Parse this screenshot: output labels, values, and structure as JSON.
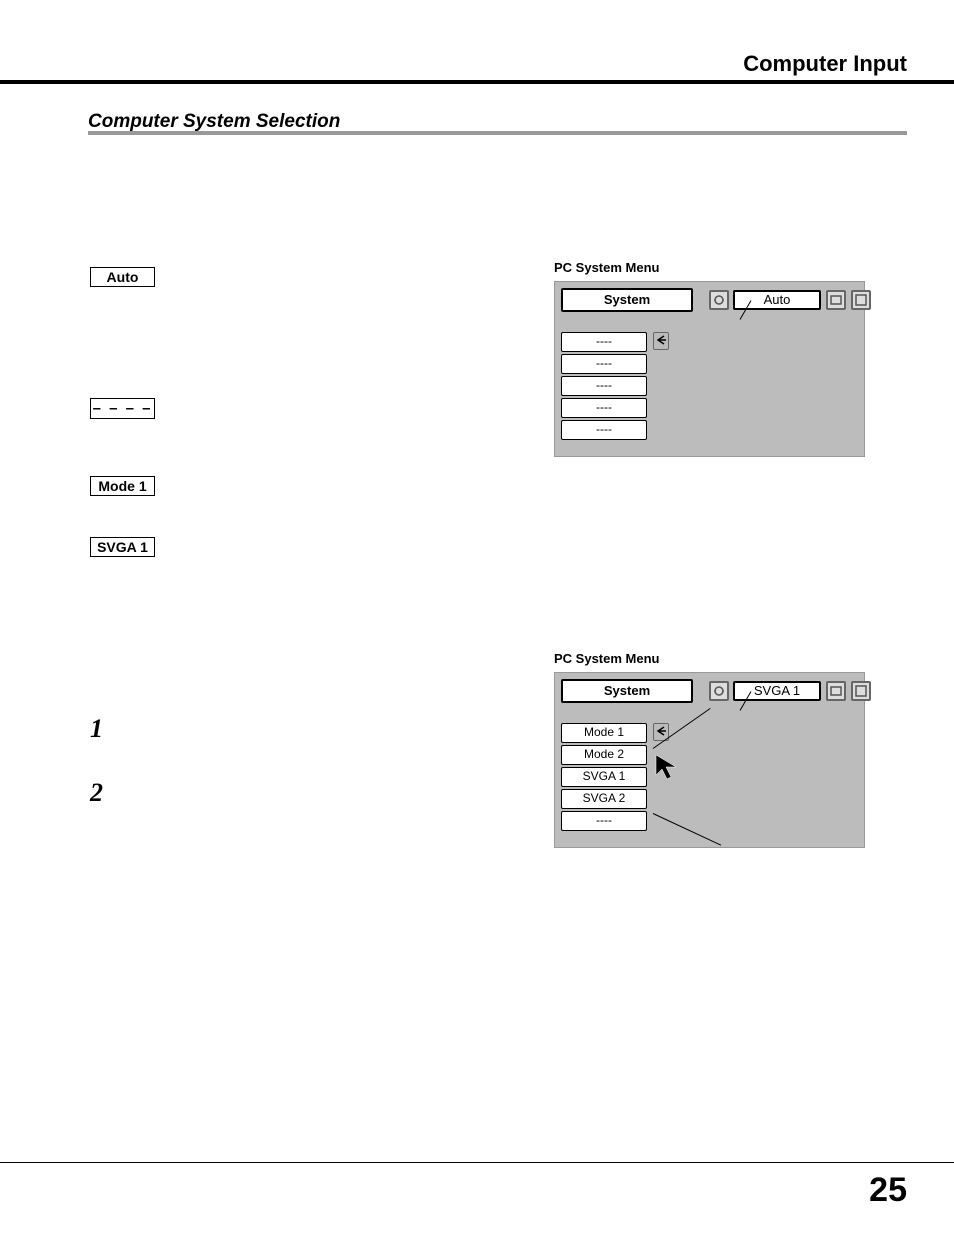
{
  "header": {
    "title": "Computer Input"
  },
  "section": {
    "title": "Computer System Selection"
  },
  "boxes": {
    "auto": "Auto",
    "dash": "– – – –",
    "mode1": "Mode 1",
    "svga1": "SVGA 1"
  },
  "menu1": {
    "caption": "PC System Menu",
    "title": "System",
    "value": "Auto",
    "items": [
      "----",
      "----",
      "----",
      "----",
      "----"
    ]
  },
  "menu2": {
    "caption": "PC System Menu",
    "title": "System",
    "value": "SVGA 1",
    "items": [
      "Mode 1",
      "Mode 2",
      "SVGA 1",
      "SVGA 2",
      "----"
    ]
  },
  "steps": {
    "one": "1",
    "two": "2"
  },
  "page": {
    "number": "25"
  }
}
